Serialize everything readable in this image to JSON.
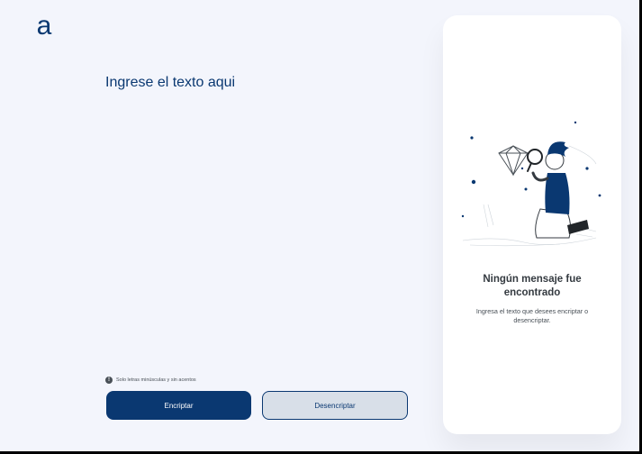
{
  "logo": {
    "icon": "alura-a-logo",
    "text": "a",
    "color": "#0a3871"
  },
  "input": {
    "placeholder": "Ingrese el texto aqui",
    "value": ""
  },
  "hint": {
    "icon": "info-icon",
    "text": "Solo letras minúsculas y sin acentos"
  },
  "buttons": {
    "encrypt": "Encriptar",
    "decrypt": "Desencriptar"
  },
  "output": {
    "illustration": "person-with-magnifying-glass-illustration",
    "title": "Ningún mensaje fue encontrado",
    "text": "Ingresa el texto que desees encriptar o desencriptar."
  },
  "colors": {
    "primary": "#0a3871",
    "background": "#f3f5fc",
    "secondary_button": "#d8dfe8"
  }
}
